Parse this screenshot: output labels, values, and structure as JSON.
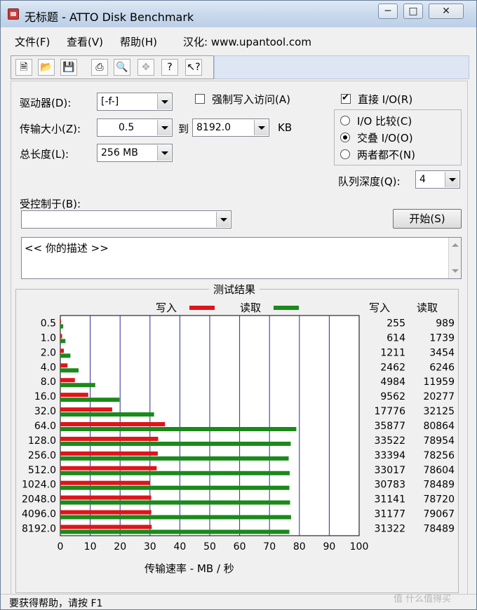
{
  "window": {
    "title": "无标题 - ATTO Disk Benchmark",
    "controls": [
      "minimize-icon",
      "maximize-icon",
      "close-icon"
    ]
  },
  "menu": {
    "items": [
      "文件(F)",
      "查看(V)",
      "帮助(H)",
      "汉化: www.upantool.com"
    ]
  },
  "toolbar": {
    "tools": [
      "new-icon",
      "open-icon",
      "save-icon",
      "print-icon",
      "preview-icon",
      "move-icon",
      "help-icon",
      "context-help-icon"
    ]
  },
  "settings": {
    "drive_label": "驱动器(D):",
    "drive_value": "[-f-]",
    "force_write_label": "强制写入访问(A)",
    "force_write_checked": false,
    "direct_io_label": "直接 I/O(R)",
    "direct_io_checked": true,
    "transfer_label": "传输大小(Z):",
    "transfer_from": "0.5",
    "transfer_to_label": "到",
    "transfer_to": "8192.0",
    "transfer_unit": "KB",
    "length_label": "总长度(L):",
    "length_value": "256 MB",
    "io_modes": [
      {
        "label": "I/O 比较(C)",
        "selected": false
      },
      {
        "label": "交叠 I/O(O)",
        "selected": true
      },
      {
        "label": "两者都不(N)",
        "selected": false
      }
    ],
    "queue_label": "队列深度(Q):",
    "queue_value": "4",
    "controlled_label": "受控制于(B):",
    "controlled_value": "",
    "start_button": "开始(S)",
    "description": "<< 你的描述 >>"
  },
  "results": {
    "title": "测试结果",
    "legend_write": "写入",
    "legend_read": "读取",
    "col_write": "写入",
    "col_read": "读取",
    "x_axis_label": "传输速率 - MB / 秒"
  },
  "chart_data": {
    "type": "bar",
    "orientation": "horizontal",
    "title": "测试结果",
    "xlabel": "传输速率 - MB / 秒",
    "xlim": [
      0,
      100
    ],
    "xticks": [
      0,
      10,
      20,
      30,
      40,
      50,
      60,
      70,
      80,
      90,
      100
    ],
    "grid": true,
    "categories": [
      "0.5",
      "1.0",
      "2.0",
      "4.0",
      "8.0",
      "16.0",
      "32.0",
      "64.0",
      "128.0",
      "256.0",
      "512.0",
      "1024.0",
      "2048.0",
      "4096.0",
      "8192.0"
    ],
    "series": [
      {
        "name": "写入",
        "color": "#e0141a",
        "values": [
          0.25,
          0.6,
          1.18,
          2.4,
          4.87,
          9.34,
          17.36,
          35.04,
          32.74,
          32.61,
          32.24,
          30.06,
          30.41,
          30.45,
          30.59
        ],
        "labels": [
          "255",
          "614",
          "1211",
          "2462",
          "4984",
          "9562",
          "17776",
          "35877",
          "33522",
          "33394",
          "33017",
          "30783",
          "31141",
          "31177",
          "31322"
        ]
      },
      {
        "name": "读取",
        "color": "#1a8a1a",
        "values": [
          0.97,
          1.7,
          3.37,
          6.1,
          11.68,
          19.8,
          31.37,
          78.97,
          77.1,
          76.42,
          76.76,
          76.65,
          76.88,
          77.21,
          76.65
        ],
        "labels": [
          "989",
          "1739",
          "3454",
          "6246",
          "11959",
          "20277",
          "32125",
          "80864",
          "78954",
          "78256",
          "78604",
          "78489",
          "78720",
          "79067",
          "78489"
        ]
      }
    ]
  },
  "status_bar": {
    "text": "要获得帮助，请按 F1"
  },
  "watermark": "值 什么值得买"
}
